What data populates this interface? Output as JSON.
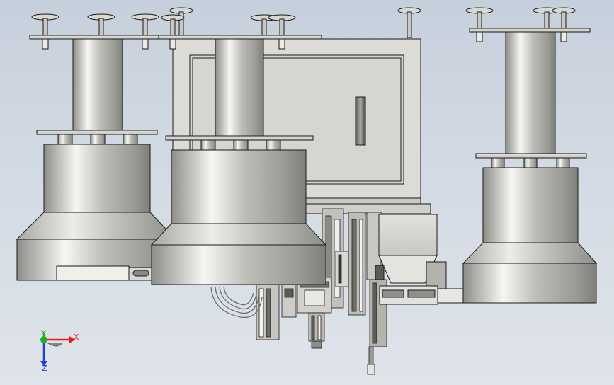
{
  "viewport": {
    "background_colors": [
      "#c6d0dc",
      "#dfe4ea"
    ]
  },
  "triad": {
    "x_label": "X",
    "y_label": "Y",
    "z_label": "Z",
    "x_color": "#e02020",
    "y_color": "#20b020",
    "z_color": "#2040d0"
  },
  "model": {
    "metal_light": "#f4f4f2",
    "metal_dark": "#8d8d88",
    "panel_fill": "#dcdbd5",
    "outline": "#1a1a1a"
  }
}
